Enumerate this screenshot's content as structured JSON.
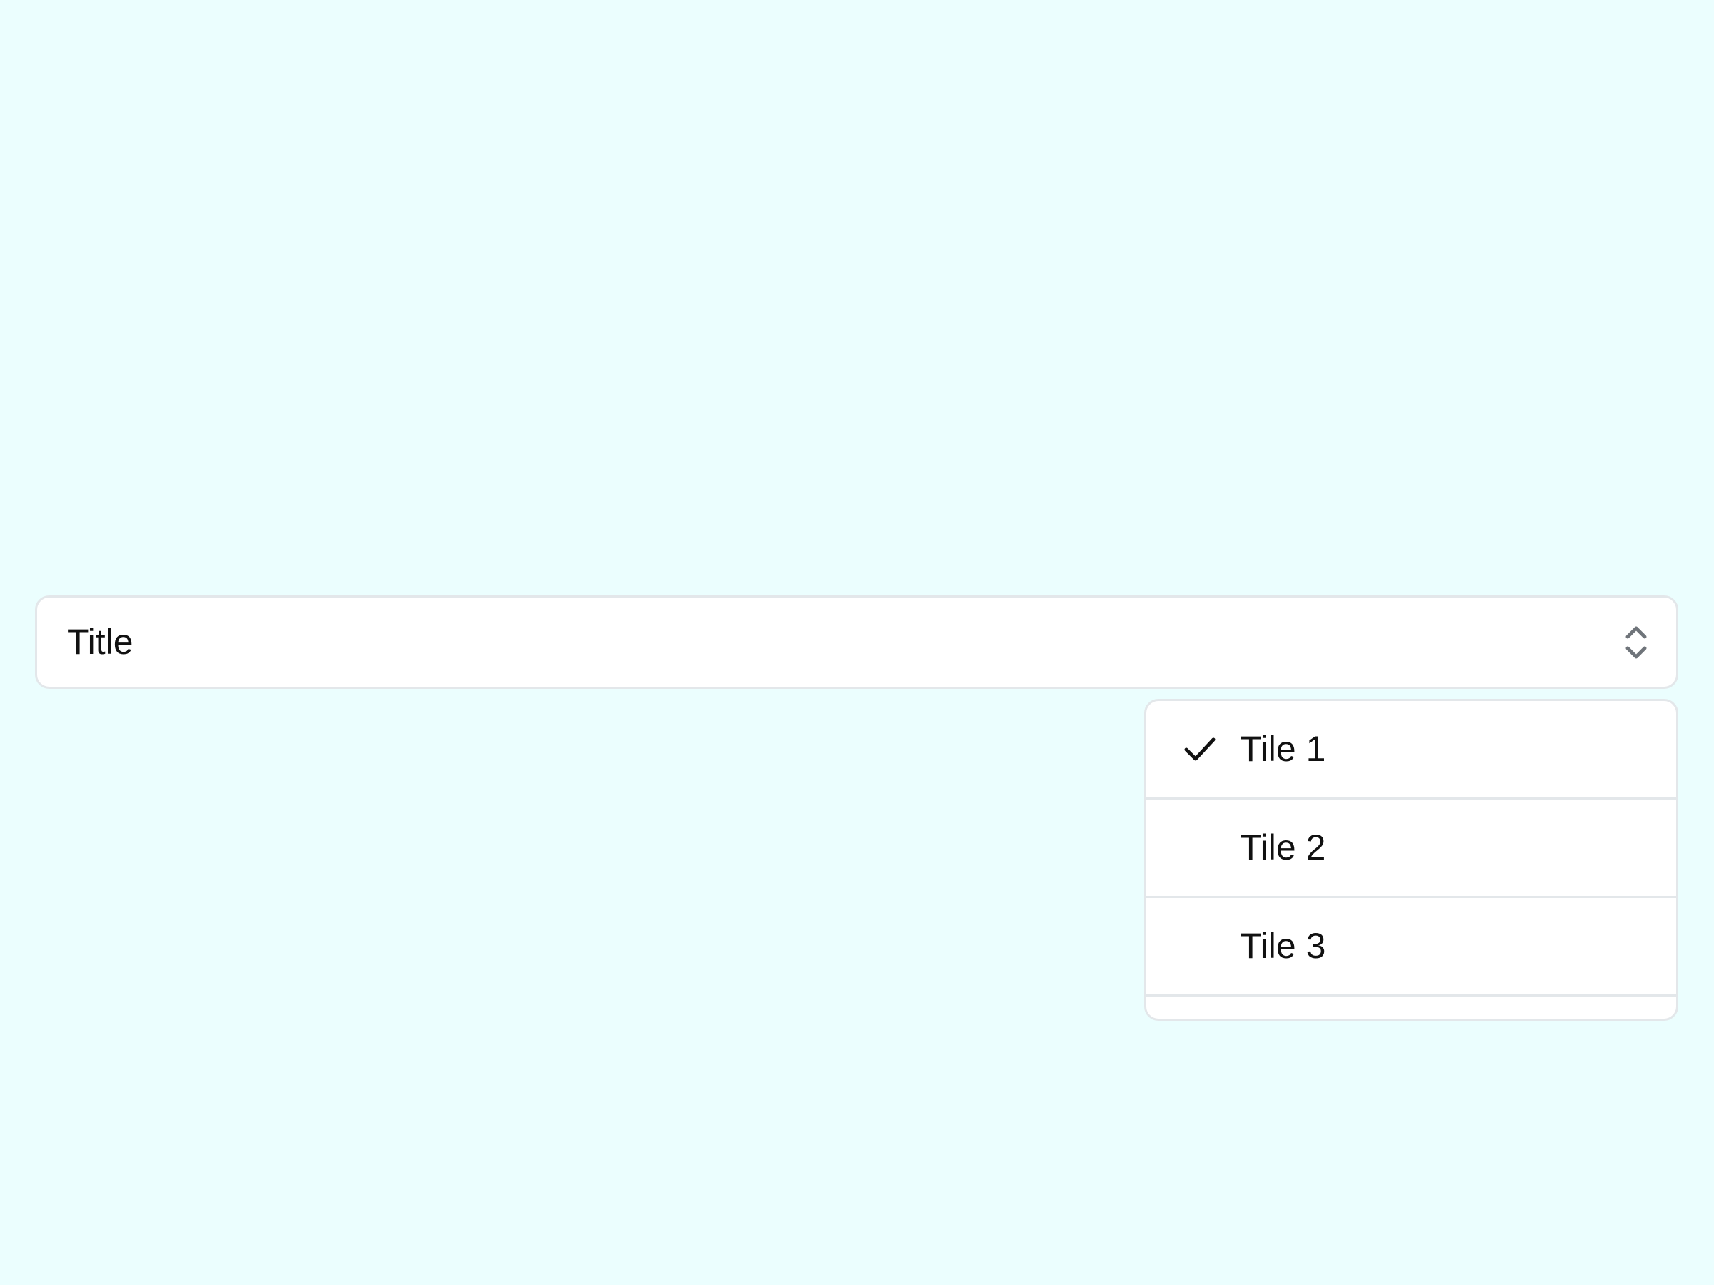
{
  "colors": {
    "background": "#ebfefe",
    "surface": "#ffffff",
    "border": "#e3e7ea",
    "text": "#111111",
    "chevron": "#6f747a"
  },
  "select": {
    "value": "Title",
    "icon": "chevron-up-down-icon"
  },
  "dropdown": {
    "options": [
      {
        "label": "Tile 1",
        "selected": true,
        "icon": "check-icon"
      },
      {
        "label": "Tile 2",
        "selected": false
      },
      {
        "label": "Tile 3",
        "selected": false
      }
    ]
  }
}
